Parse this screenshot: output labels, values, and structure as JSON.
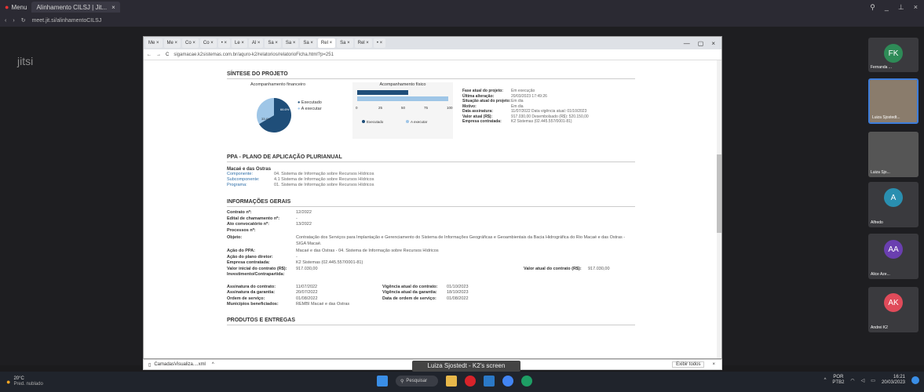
{
  "outer_browser": {
    "menu_label": "Menu",
    "tab_title": "Alinhamento CILSJ | Jit...",
    "url": "meet.jit.si/alinhamentoCILSJ"
  },
  "jitsi": {
    "logo": "jitsi",
    "screen_share_label": "Luiza Sjostedt - K2's screen",
    "participants": [
      {
        "name": "Fernanda ...",
        "initials": "FK",
        "color": "#2e8b57"
      },
      {
        "name": "Luiza Sjostedt...",
        "initials": "",
        "color": "#6b5b4b"
      },
      {
        "name": "Luiza Sjo...",
        "initials": "",
        "color": "#555"
      },
      {
        "name": "Alfredo",
        "initials": "A",
        "color": "#2a8fb0"
      },
      {
        "name": "Alice Aze...",
        "initials": "AA",
        "color": "#6a3fb0"
      },
      {
        "name": "Andrei K2",
        "initials": "AK",
        "color": "#e04b5a"
      }
    ]
  },
  "inner_browser": {
    "tabs": [
      "Me",
      "Me",
      "Co",
      "Co",
      "",
      "Le",
      "Al",
      "Sa",
      "Sa",
      "Sa",
      "Rel",
      "Sa",
      "Rel",
      ""
    ],
    "url": "sigamacae.k2sistemas.com.br/aquro-k2/relatorios/relatorioFicha.html?p=251"
  },
  "document": {
    "synthesis_title": "SÍNTESE DO PROJETO",
    "financial_label": "Acompanhamento financeiro",
    "physical_label": "Acompanhamento físico",
    "legend_executed": "Executado",
    "legend_to_execute": "A executar",
    "pie_executed_label": "66.6%",
    "pie_pending_label": "33.4%",
    "axis_ticks": [
      "0",
      "25",
      "50",
      "75",
      "100"
    ],
    "status_rows": [
      {
        "k": "Fase atual do projeto:",
        "v": "Em execução"
      },
      {
        "k": "Última alteração:",
        "v": "20/03/2023 17:49:26"
      },
      {
        "k": "Situação atual do projeto:",
        "v": "Em dia"
      },
      {
        "k": "Motivo:",
        "v": "Em dia"
      },
      {
        "k": "Data assinatura:",
        "v": "11/07/2022 Data vigência atual: 01/10/2023"
      },
      {
        "k": "Valor atual (R$):",
        "v": "917.030,00 Desembolsado (R$): 520.150,00"
      },
      {
        "k": "Empresa contratada:",
        "v": "K2 Sistemas (02.445.557/0001-81)"
      }
    ],
    "ppa_title": "PPA - PLANO DE APLICAÇÃO PLURIANUAL",
    "ppa_region": "Macaé e das Ostras",
    "ppa_rows": [
      {
        "k": "Componente:",
        "v": "04. Sistema de Informação sobre Recursos Hídricos"
      },
      {
        "k": "Subcomponente:",
        "v": "4.1 Sistema de Informação sobre Recursos Hídricos"
      },
      {
        "k": "Programa:",
        "v": "01. Sistema de Informação sobre Recursos Hídricos"
      }
    ],
    "general_title": "INFORMAÇÕES GERAIS",
    "general_rows": [
      {
        "k": "Contrato nº:",
        "v": "12/2022"
      },
      {
        "k": "Edital de chamamento nº:",
        "v": "-"
      },
      {
        "k": "Ato convocatório nº:",
        "v": "13/2022"
      },
      {
        "k": "Processos nº:",
        "v": ""
      },
      {
        "k": "Objeto:",
        "v": "Contratação dos Serviços para Implantação e Gerenciamento do Sistema de Informações Geográficas e Geoambientais da Bacia Hidrográfica do Rio Macaé e das Ostras - SIGA Macaé."
      },
      {
        "k": "Ação do PPA:",
        "v": "Macaé e das Ostras - 04. Sistema de Informação sobre Recursos Hídricos"
      },
      {
        "k": "Ação do plano diretor:",
        "v": "-"
      },
      {
        "k": "Empresa contratada:",
        "v": "K2 Sistemas (02.445.557/0001-81)"
      },
      {
        "k": "Valor inicial do contrato (R$):",
        "v": "917.030,00"
      },
      {
        "k": "Investimento/Contrapartida:",
        "v": ""
      }
    ],
    "current_value_label": "Valor atual do contrato (R$):",
    "current_value": "917.030,00",
    "signature_rows": [
      {
        "k": "Assinatura do contrato:",
        "v": "11/07/2022",
        "k2": "Vigência atual do contrato:",
        "v2": "01/10/2023"
      },
      {
        "k": "Assinatura da garantia:",
        "v": "20/07/2022",
        "k2": "Vigência atual da garantia:",
        "v2": "18/10/2023"
      },
      {
        "k": "Ordem de serviço:",
        "v": "01/08/2022",
        "k2": "Data de ordem de serviço:",
        "v2": "01/08/2022"
      },
      {
        "k": "Municípios beneficiados:",
        "v": "REMBI Macaé e das Ostras",
        "k2": "",
        "v2": ""
      }
    ],
    "products_title": "PRODUTOS E ENTREGAS"
  },
  "download_bar": {
    "file": "CamadasVisualiza....xml",
    "show_all": "Exibir todos"
  },
  "taskbar": {
    "weather": "20°C",
    "weather_desc": "Pred. nublado",
    "search": "Pesquisar",
    "lang": "POR",
    "lang2": "PTB2",
    "time": "16:21",
    "date": "20/03/2023"
  },
  "chart_data": [
    {
      "type": "pie",
      "title": "Acompanhamento financeiro",
      "categories": [
        "Executado",
        "A executar"
      ],
      "values": [
        66.6,
        33.4
      ]
    },
    {
      "type": "bar",
      "title": "Acompanhamento físico",
      "categories": [
        "Executado",
        "A executar"
      ],
      "values": [
        56,
        44
      ],
      "xlim": [
        0,
        100
      ]
    }
  ]
}
